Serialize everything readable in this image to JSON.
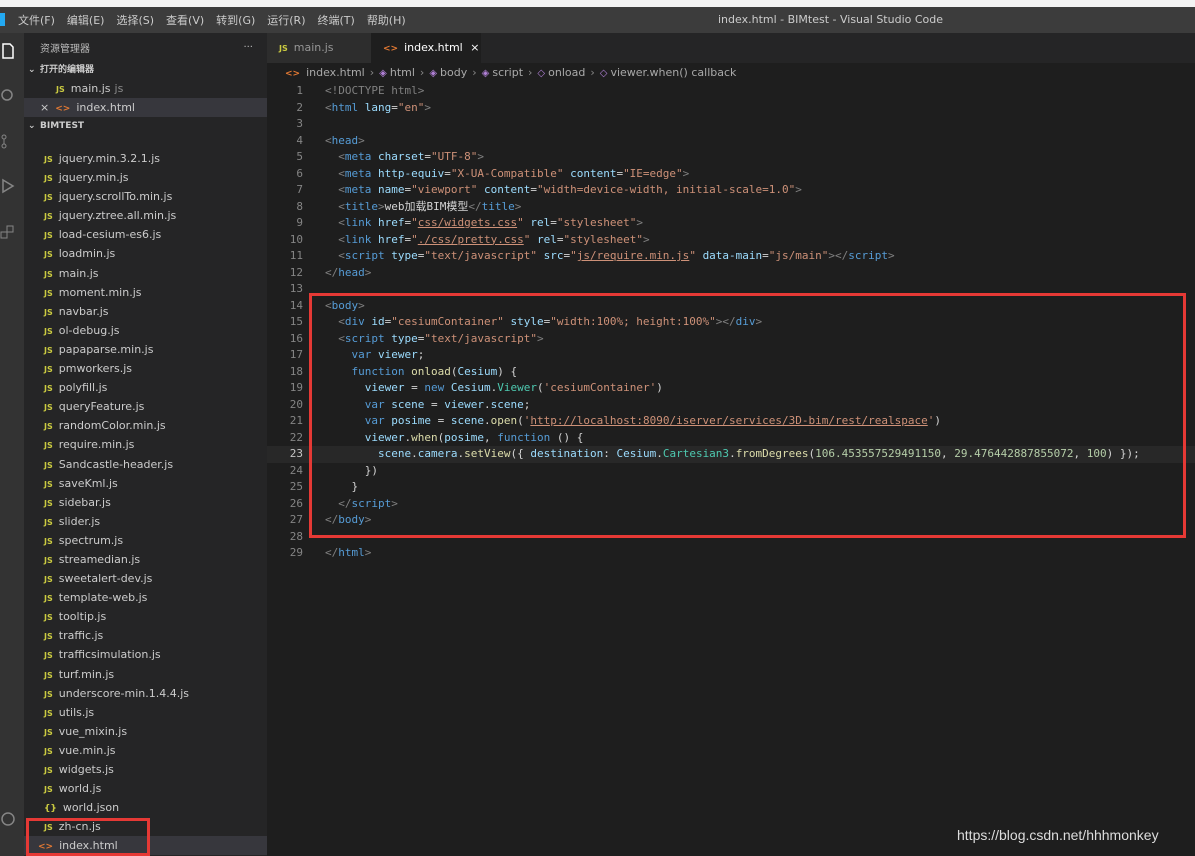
{
  "window": {
    "title": "index.html - BIMtest - Visual Studio Code",
    "menu": [
      "文件(F)",
      "编辑(E)",
      "选择(S)",
      "查看(V)",
      "转到(G)",
      "运行(R)",
      "终端(T)",
      "帮助(H)"
    ]
  },
  "sidebar": {
    "header": "资源管理器",
    "more": "···",
    "open_editors_label": "打开的编辑器",
    "open_editors": [
      {
        "name": "main.js",
        "hint": "js"
      },
      {
        "name": "index.html",
        "close": "×"
      }
    ],
    "folder_label": "BIMTEST",
    "files": [
      {
        "name": "jquery.min.3.2.1.js",
        "icon": "JS"
      },
      {
        "name": "jquery.min.js",
        "icon": "JS"
      },
      {
        "name": "jquery.scrollTo.min.js",
        "icon": "JS"
      },
      {
        "name": "jquery.ztree.all.min.js",
        "icon": "JS"
      },
      {
        "name": "load-cesium-es6.js",
        "icon": "JS"
      },
      {
        "name": "loadmin.js",
        "icon": "JS"
      },
      {
        "name": "main.js",
        "icon": "JS"
      },
      {
        "name": "moment.min.js",
        "icon": "JS"
      },
      {
        "name": "navbar.js",
        "icon": "JS"
      },
      {
        "name": "ol-debug.js",
        "icon": "JS"
      },
      {
        "name": "papaparse.min.js",
        "icon": "JS"
      },
      {
        "name": "pmworkers.js",
        "icon": "JS"
      },
      {
        "name": "polyfill.js",
        "icon": "JS"
      },
      {
        "name": "queryFeature.js",
        "icon": "JS"
      },
      {
        "name": "randomColor.min.js",
        "icon": "JS"
      },
      {
        "name": "require.min.js",
        "icon": "JS"
      },
      {
        "name": "Sandcastle-header.js",
        "icon": "JS"
      },
      {
        "name": "saveKml.js",
        "icon": "JS"
      },
      {
        "name": "sidebar.js",
        "icon": "JS"
      },
      {
        "name": "slider.js",
        "icon": "JS"
      },
      {
        "name": "spectrum.js",
        "icon": "JS"
      },
      {
        "name": "streamedian.js",
        "icon": "JS"
      },
      {
        "name": "sweetalert-dev.js",
        "icon": "JS"
      },
      {
        "name": "template-web.js",
        "icon": "JS"
      },
      {
        "name": "tooltip.js",
        "icon": "JS"
      },
      {
        "name": "traffic.js",
        "icon": "JS"
      },
      {
        "name": "trafficsimulation.js",
        "icon": "JS"
      },
      {
        "name": "turf.min.js",
        "icon": "JS"
      },
      {
        "name": "underscore-min.1.4.4.js",
        "icon": "JS"
      },
      {
        "name": "utils.js",
        "icon": "JS"
      },
      {
        "name": "vue_mixin.js",
        "icon": "JS"
      },
      {
        "name": "vue.min.js",
        "icon": "JS"
      },
      {
        "name": "widgets.js",
        "icon": "JS"
      },
      {
        "name": "world.js",
        "icon": "JS"
      },
      {
        "name": "world.json",
        "icon": "{}"
      },
      {
        "name": "zh-cn.js",
        "icon": "JS"
      }
    ],
    "selected_file": "index.html"
  },
  "tabs": [
    {
      "label": "main.js",
      "active": false
    },
    {
      "label": "index.html",
      "active": true,
      "close": "×"
    }
  ],
  "breadcrumb": [
    "index.html",
    "html",
    "body",
    "script",
    "onload",
    "viewer.when() callback"
  ],
  "editor": {
    "current_line": 23,
    "line_numbers": [
      "1",
      "2",
      "3",
      "4",
      "5",
      "6",
      "7",
      "8",
      "9",
      "10",
      "11",
      "12",
      "13",
      "14",
      "15",
      "16",
      "17",
      "18",
      "19",
      "20",
      "21",
      "22",
      "23",
      "24",
      "25",
      "26",
      "27",
      "28",
      "29"
    ],
    "strings": {
      "doctype": "<!DOCTYPE html>",
      "lang": "\"en\"",
      "charset": "\"UTF-8\"",
      "xua": "\"X-UA-Compatible\"",
      "ieedge": "\"IE=edge\"",
      "viewport": "\"viewport\"",
      "viewport_content": "\"width=device-width, initial-scale=1.0\"",
      "title_text": "web加载BIM模型",
      "css_widgets": "css/widgets.css",
      "css_pretty": "./css/pretty.css",
      "stylesheet": "\"stylesheet\"",
      "text_js": "\"text/javascript\"",
      "require_src": "js/require.min.js",
      "data_main": "\"js/main\"",
      "container_id": "\"cesiumContainer\"",
      "container_style": "\"width:100%; height:100%\"",
      "viewer_arg": "'cesiumContainer'",
      "realspace_url": "http://localhost:8090/iserver/services/3D-bim/rest/realspace",
      "lng": "106.453557529491150",
      "lat": "29.476442887855072",
      "height": "100"
    }
  },
  "watermark": "https://blog.csdn.net/hhhmonkey"
}
